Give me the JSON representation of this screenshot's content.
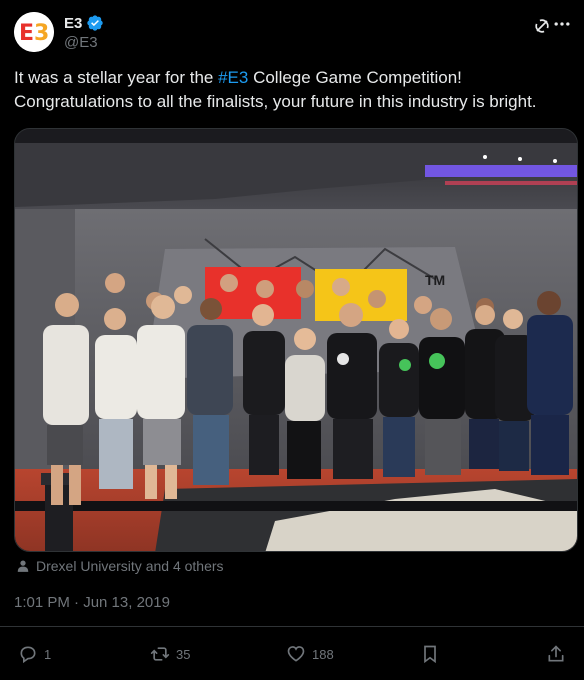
{
  "account": {
    "display_name": "E3",
    "handle": "@E3",
    "verified": true,
    "avatar_text": "E3",
    "avatar_colors": [
      "#e8312b",
      "#f5a623"
    ],
    "verified_color": "#1d9bf0"
  },
  "tweet": {
    "text_before_hashtag": "It was a stellar year for the ",
    "hashtag": "#E3",
    "text_after_hashtag": " College Game Competition! Congratulations to all the finalists, your future in this industry is bright.",
    "tagged_people": "Drexel University and 4 others",
    "timestamp": "1:01 PM · Jun 13, 2019"
  },
  "media": {
    "tm_label": "TM",
    "logo_colors": [
      "#e8312b",
      "#f5c518"
    ],
    "accent_light": "#7c5cff"
  },
  "actions": {
    "reply_count": "1",
    "retweet_count": "35",
    "like_count": "188",
    "reply_icon": "reply-icon",
    "retweet_icon": "retweet-icon",
    "like_icon": "heart-icon",
    "bookmark_icon": "bookmark-icon",
    "share_icon": "share-icon"
  },
  "colors": {
    "background": "#000000",
    "text": "#e7e9ea",
    "muted": "#71767b",
    "link": "#1d9bf0",
    "border": "#2f3336"
  }
}
